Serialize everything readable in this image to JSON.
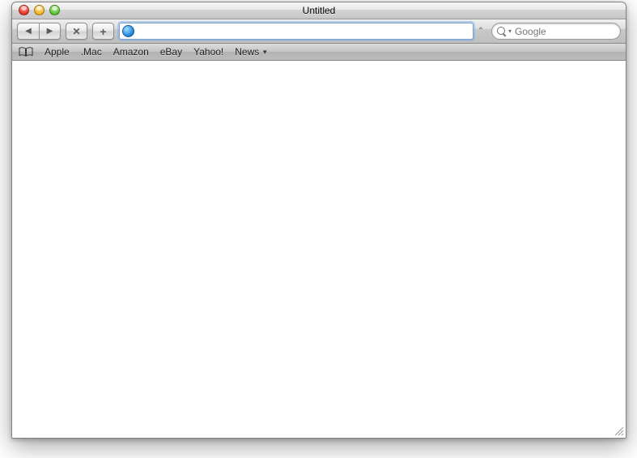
{
  "window": {
    "title": "Untitled"
  },
  "toolbar": {
    "url_value": "",
    "search_placeholder": "Google"
  },
  "bookmarks": {
    "items": [
      {
        "label": "Apple"
      },
      {
        "label": ".Mac"
      },
      {
        "label": "Amazon"
      },
      {
        "label": "eBay"
      },
      {
        "label": "Yahoo!"
      },
      {
        "label": "News",
        "has_menu": true
      }
    ]
  }
}
